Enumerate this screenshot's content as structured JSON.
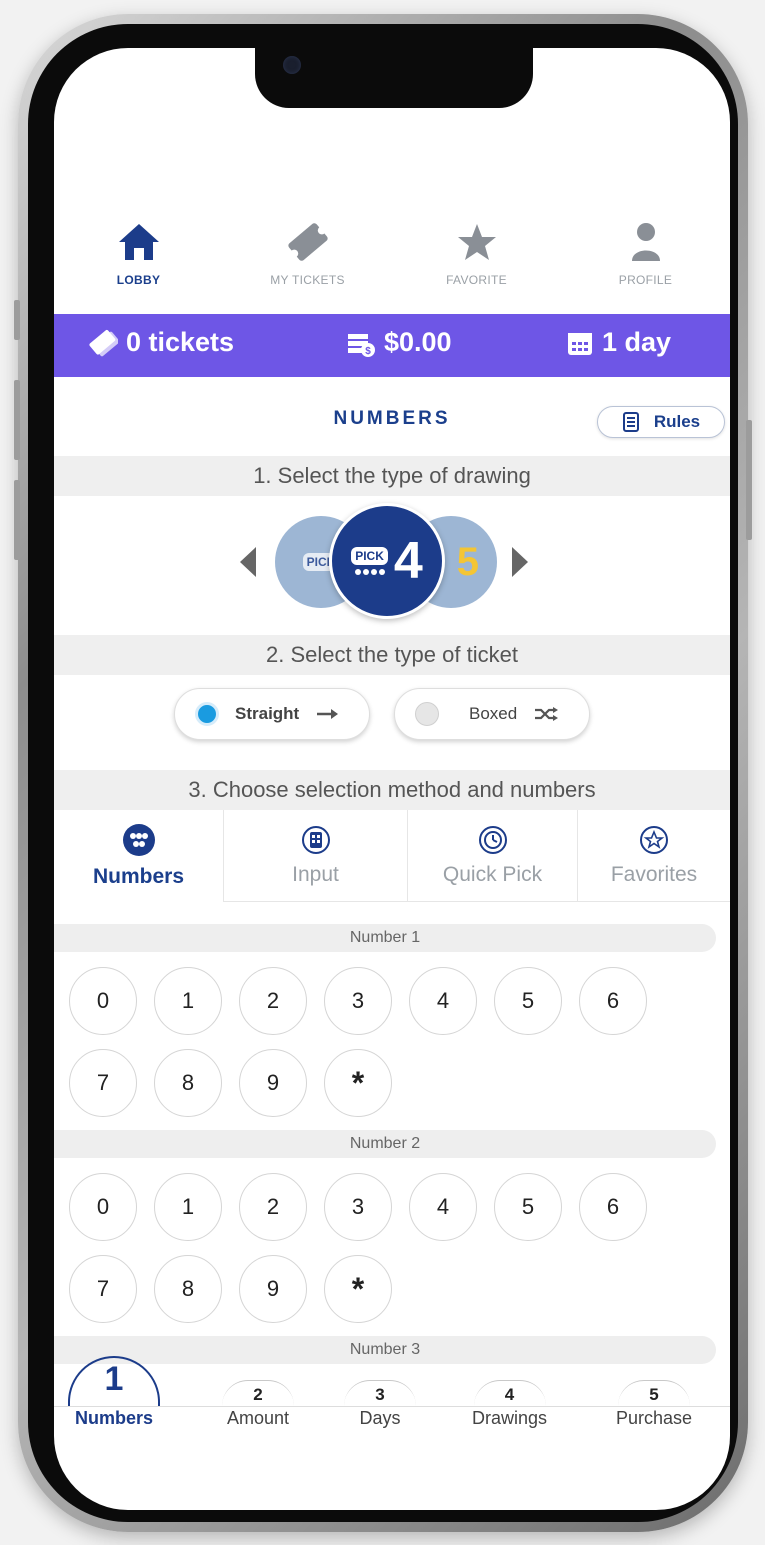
{
  "nav": [
    {
      "label": "LOBBY",
      "icon": "home-icon",
      "active": true
    },
    {
      "label": "MY TICKETS",
      "icon": "ticket-icon",
      "active": false
    },
    {
      "label": "FAVORITE",
      "icon": "star-icon",
      "active": false
    },
    {
      "label": "PROFILE",
      "icon": "user-icon",
      "active": false
    }
  ],
  "status": {
    "tickets": "0 tickets",
    "amount": "$0.00",
    "days": "1 day"
  },
  "page_title": "NUMBERS",
  "rules_label": "Rules",
  "steps": {
    "s1": "1. Select the type of drawing",
    "s2": "2. Select the type of ticket",
    "s3": "3. Choose selection method and numbers"
  },
  "drawing": {
    "options": [
      "PICK",
      "PICK 4",
      "5"
    ],
    "selected_tag": "PICK",
    "selected_number": "4",
    "side_left_tag": "PICK",
    "side_right_number": "5"
  },
  "ticket_types": [
    {
      "label": "Straight",
      "selected": true
    },
    {
      "label": "Boxed",
      "selected": false
    }
  ],
  "method_tabs": [
    {
      "label": "Numbers",
      "icon": "dots-icon",
      "active": true
    },
    {
      "label": "Input",
      "icon": "keypad-icon",
      "active": false
    },
    {
      "label": "Quick Pick",
      "icon": "clock-icon",
      "active": false
    },
    {
      "label": "Favorites",
      "icon": "star-circle-icon",
      "active": false
    }
  ],
  "number_groups": [
    {
      "title": "Number 1",
      "row1": [
        "0",
        "1",
        "2",
        "3",
        "4",
        "5",
        "6"
      ],
      "row2": [
        "7",
        "8",
        "9",
        "*"
      ]
    },
    {
      "title": "Number 2",
      "row1": [
        "0",
        "1",
        "2",
        "3",
        "4",
        "5",
        "6"
      ],
      "row2": [
        "7",
        "8",
        "9",
        "*"
      ]
    },
    {
      "title": "Number 3"
    }
  ],
  "stepper": [
    {
      "num": "1",
      "label": "Numbers",
      "active": true
    },
    {
      "num": "2",
      "label": "Amount",
      "active": false
    },
    {
      "num": "3",
      "label": "Days",
      "active": false
    },
    {
      "num": "4",
      "label": "Drawings",
      "active": false
    },
    {
      "num": "5",
      "label": "Purchase",
      "active": false
    }
  ],
  "colors": {
    "primary": "#1c3c8a",
    "status_bar": "#6e56e6",
    "radio_active": "#1a9be0"
  }
}
